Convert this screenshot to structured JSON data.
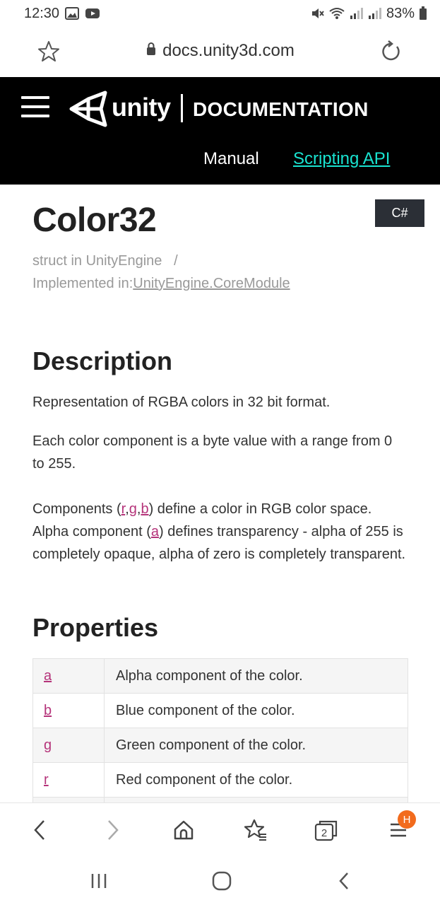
{
  "status_bar": {
    "time": "12:30",
    "battery": "83%"
  },
  "browser": {
    "url": "docs.unity3d.com"
  },
  "header": {
    "brand": "unity",
    "section": "DOCUMENTATION",
    "nav": {
      "manual": "Manual",
      "scripting_api": "Scripting API"
    },
    "colors": {
      "background": "#000000",
      "active_link": "#19e3d0"
    }
  },
  "page": {
    "language": "C#",
    "title": "Color32",
    "meta": {
      "kind": "struct in UnityEngine",
      "separator": "/",
      "implemented_label": "Implemented in:",
      "implemented_link": "UnityEngine.CoreModule"
    },
    "description": {
      "heading": "Description",
      "p1": "Representation of RGBA colors in 32 bit format.",
      "p2": "Each color component is a byte value with a range from 0 to 255.",
      "p3_before": "Components (",
      "p3_r": "r",
      "p3_comma1": ",",
      "p3_g": "g",
      "p3_comma2": ",",
      "p3_b": "b",
      "p3_mid": ") define a color in RGB color space. Alpha component (",
      "p3_a": "a",
      "p3_after": ") defines transparency - alpha of 255 is completely opaque, alpha of zero is completely transparent."
    },
    "properties": {
      "heading": "Properties",
      "rows": [
        {
          "name": "a",
          "desc": "Alpha component of the color."
        },
        {
          "name": "b",
          "desc": "Blue component of the color."
        },
        {
          "name": "g",
          "desc": "Green component of the color."
        },
        {
          "name": "r",
          "desc": "Red component of the color."
        }
      ]
    },
    "link_color": "#b5347a"
  },
  "toolbar": {
    "tabs_count": "2",
    "menu_badge": "H"
  }
}
